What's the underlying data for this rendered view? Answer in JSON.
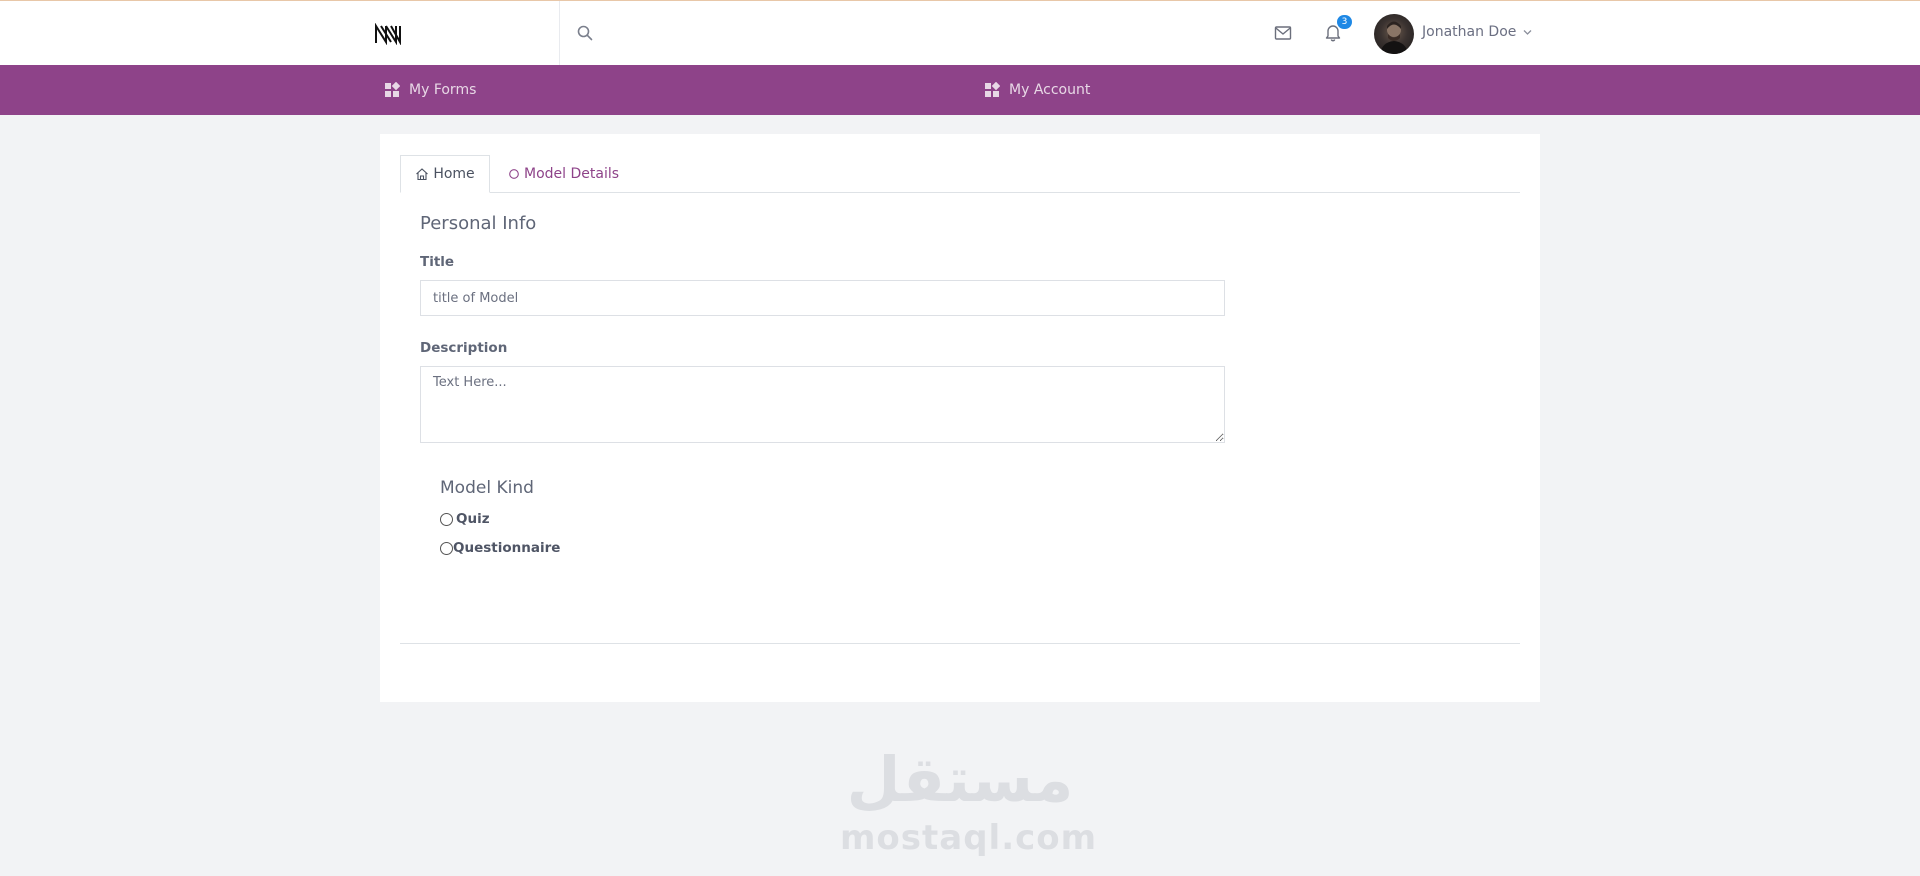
{
  "header": {
    "notification_count": "3",
    "user_name": "Jonathan Doe"
  },
  "nav": {
    "items": [
      {
        "label": "My Forms",
        "icon": "dashboard-icon"
      },
      {
        "label": "My Account",
        "icon": "dashboard-icon"
      }
    ]
  },
  "tabs": [
    {
      "label": "Home",
      "icon": "home-icon",
      "active": true
    },
    {
      "label": "Model Details",
      "icon": "circle-icon",
      "active": false
    }
  ],
  "form": {
    "section_title": "Personal Info",
    "title_label": "Title",
    "title_placeholder": "title of Model",
    "description_label": "Description",
    "description_placeholder": "Text Here...",
    "kind_title": "Model Kind",
    "kind_options": [
      "Quiz",
      "Questionnaire"
    ]
  },
  "watermark": {
    "arabic": "مستقل",
    "latin": "mostaql.com"
  },
  "colors": {
    "nav_background": "#8e4389",
    "accent": "#8e4389",
    "badge": "#1e88e5",
    "page_background": "#f2f3f5"
  }
}
